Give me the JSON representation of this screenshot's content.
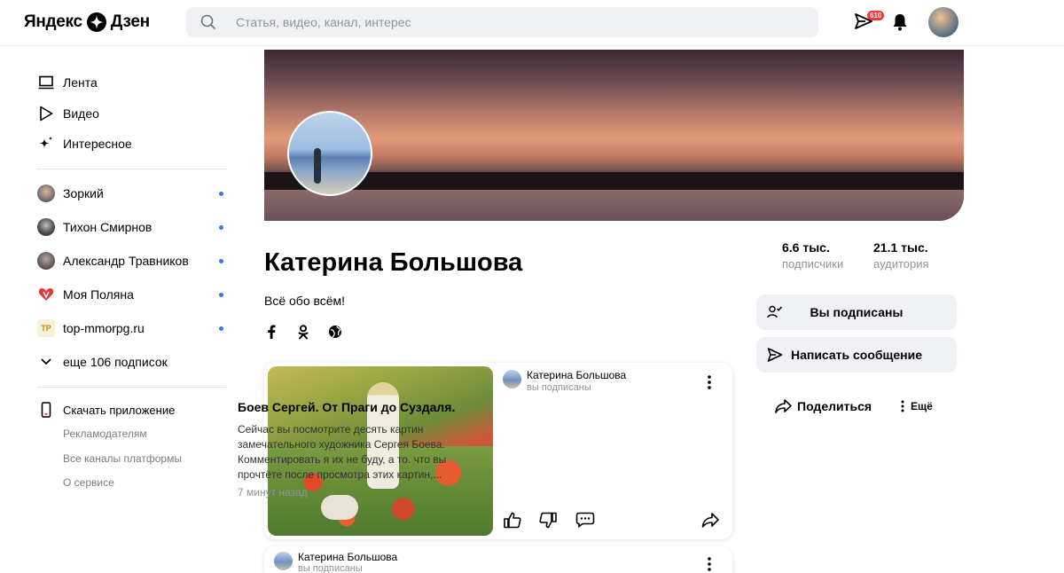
{
  "header": {
    "logo_left": "Яндекс",
    "logo_right": "Дзен",
    "search_placeholder": "Статья, видео, канал, интерес",
    "messages_badge": "610"
  },
  "sidebar": {
    "nav": [
      {
        "label": "Лента",
        "icon": "monitor-icon"
      },
      {
        "label": "Видео",
        "icon": "play-icon"
      },
      {
        "label": "Интересное",
        "icon": "sparkle-icon"
      }
    ],
    "subscriptions": [
      {
        "label": "Зоркий"
      },
      {
        "label": "Тихон Смирнов"
      },
      {
        "label": "Александр Травников"
      },
      {
        "label": "Моя Поляна"
      },
      {
        "label": "top-mmorpg.ru"
      }
    ],
    "more_subscriptions": "еще 106 подписок",
    "download_app": "Скачать приложение",
    "footer_links": [
      "Рекламодателям",
      "Все каналы платформы",
      "О сервисе"
    ]
  },
  "channel": {
    "name": "Катерина Большова",
    "description": "Всё обо всём!",
    "subscribers_value": "6.6 тыс.",
    "subscribers_label": "подписчики",
    "audience_value": "21.1 тыс.",
    "audience_label": "аудитория",
    "subscribed_button": "Вы подписаны",
    "message_button": "Написать сообщение",
    "share_label": "Поделиться",
    "more_label": "Ещё"
  },
  "feed": [
    {
      "author": "Катерина Большова",
      "status": "вы подписаны",
      "title": "Боев Сергей. От Праги до Суздаля.",
      "snippet": "Сейчас вы посмотрите десять картин замечательного художника Сергея Боева. Комментировать я их не буду, а то. что вы прочтёте после просмотра этих картин,...",
      "time": "7 минут назад"
    },
    {
      "author": "Катерина Большова",
      "status": "вы подписаны"
    }
  ]
}
